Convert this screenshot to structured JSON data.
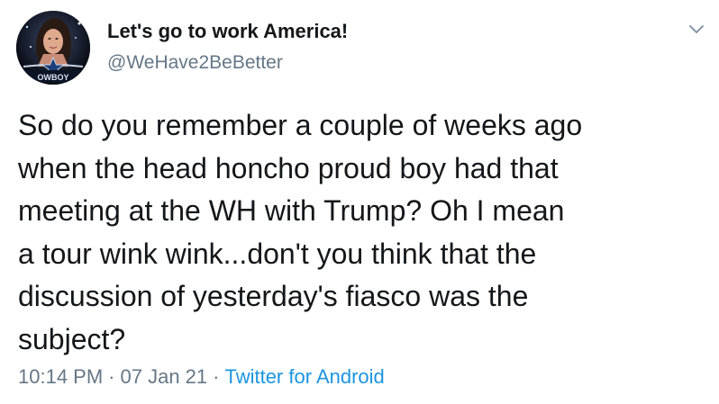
{
  "user": {
    "display_name": "Let's go to work America!",
    "handle": "@WeHave2BeBetter",
    "avatar_icon": "profile-photo-with-star-emblem",
    "avatar_badge_text": "OWBOY"
  },
  "tweet": {
    "lines": [
      "So do you remember a couple of weeks ago",
      "when the head honcho proud boy had that",
      "meeting at the WH with Trump? Oh I mean",
      "a tour wink wink...don't you think that the",
      "discussion of yesterday's fiasco was the",
      "subject?"
    ],
    "time": "10:14 PM",
    "separator": "·",
    "date": "07 Jan 21",
    "source": "Twitter for Android"
  },
  "icons": {
    "menu": "chevron-down-icon"
  },
  "colors": {
    "text": "#14171a",
    "secondary": "#657786",
    "link": "#1b95e0",
    "background": "#ffffff"
  }
}
